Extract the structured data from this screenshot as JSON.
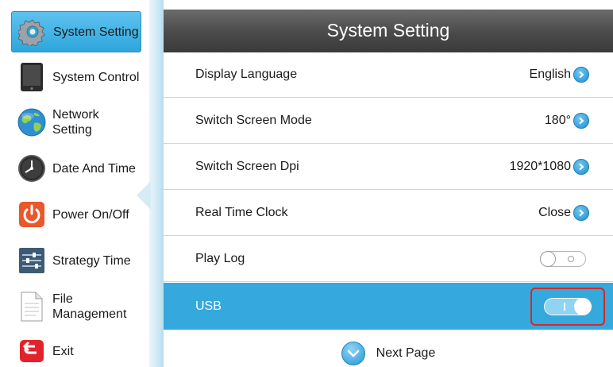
{
  "sidebar": {
    "items": [
      {
        "label": "System Setting",
        "icon": "gear-icon",
        "active": true
      },
      {
        "label": "System Control",
        "icon": "tablet-icon"
      },
      {
        "label": "Network Setting",
        "icon": "globe-icon"
      },
      {
        "label": "Date And Time",
        "icon": "clock-icon"
      },
      {
        "label": "Power On/Off",
        "icon": "power-icon"
      },
      {
        "label": "Strategy Time",
        "icon": "sliders-icon"
      },
      {
        "label": "File Management",
        "label_line1": "File",
        "label_line2": "Management",
        "icon": "document-icon"
      },
      {
        "label": "Exit",
        "icon": "exit-icon"
      }
    ]
  },
  "header": {
    "title": "System Setting"
  },
  "rows": [
    {
      "label": "Display Language",
      "value": "English",
      "control": "chevron"
    },
    {
      "label": "Switch Screen Mode",
      "value": "180°",
      "control": "chevron"
    },
    {
      "label": "Switch Screen Dpi",
      "value": "1920*1080",
      "control": "chevron"
    },
    {
      "label": "Real Time Clock",
      "value": "Close",
      "control": "chevron"
    },
    {
      "label": "Play Log",
      "value": "",
      "control": "toggle",
      "state": "off"
    },
    {
      "label": "USB",
      "value": "",
      "control": "toggle",
      "state": "on",
      "selected": true,
      "highlighted_by_red_box": true
    }
  ],
  "footer": {
    "next_label": "Next Page"
  },
  "colors": {
    "accent": "#35a8dd",
    "header_bg": "#4a4a4a",
    "highlight_box": "#d12a2a"
  }
}
